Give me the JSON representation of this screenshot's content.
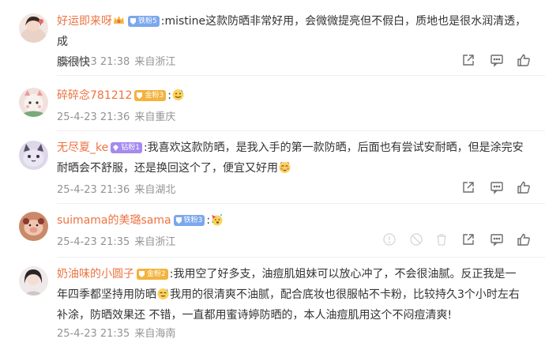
{
  "comments": [
    {
      "username": "好运即来呀",
      "badge": "铁粉5",
      "badge_color": "#7ba7ee",
      "text_line1": ":mistine这款防晒非常好用，会微微提亮但不假白，质地也是很水润清透，成",
      "text_line2": "膜很快",
      "time": "25-4-23 21:38",
      "source": "来自浙江",
      "avatar_colors": [
        "#f2d3c8",
        "#3a2a24"
      ]
    },
    {
      "username": "碎碎念781212",
      "badge": "金粉3",
      "badge_color": "#f3b33d",
      "text_line1": ":",
      "text_line2": "",
      "emoji": "sweat-emoji",
      "time": "25-4-23 21:36",
      "source": "来自重庆",
      "avatar_colors": [
        "#e9c7c0",
        "#6a8f6a"
      ]
    },
    {
      "username": "无尽夏_ke",
      "badge": "钻粉1",
      "badge_color": "#a58af0",
      "text_line1": ":我喜欢这款防晒，是我入手的第一款防晒，后面也有尝试安耐晒，但是涂完安",
      "text_line2": "耐晒会不舒服，还是换回这个了，便宜又好用",
      "emoji": "blush-emoji",
      "time": "25-4-23 21:36",
      "source": "来自湖北",
      "avatar_colors": [
        "#d8d3e6",
        "#5a4f6b"
      ]
    },
    {
      "username": "suimama的美璐sama",
      "badge": "铁粉3",
      "badge_color": "#7ba7ee",
      "text_line1": ":",
      "text_line2": "",
      "emoji": "party-emoji",
      "time": "25-4-23 21:35",
      "source": "来自浙江",
      "avatar_colors": [
        "#e7b9a3",
        "#8a3a2e"
      ]
    },
    {
      "username": "奶油味的小圆子",
      "badge": "金粉2",
      "badge_color": "#f3b33d",
      "text_line1": ":我用空了好多支，油痘肌姐妹可以放心冲了，不会很油腻。反正我是一",
      "text_line2a": "年四季都坚持用防晒",
      "text_line2b": "我用的很清爽不油腻，配合底妆也很服帖不卡粉，比较持久3个小时左右",
      "text_line3": "补涂，防晒效果还 不错，一直都用蜜诗婷防晒的，本人油痘肌用这个不闷痘清爽!",
      "emoji": "sweat-smile-emoji",
      "time": "25-4-23 21:35",
      "source": "来自海南",
      "avatar_colors": [
        "#f0e6e6",
        "#2b2424"
      ]
    }
  ],
  "actions": [
    "share-icon",
    "comment-icon",
    "like-icon"
  ]
}
